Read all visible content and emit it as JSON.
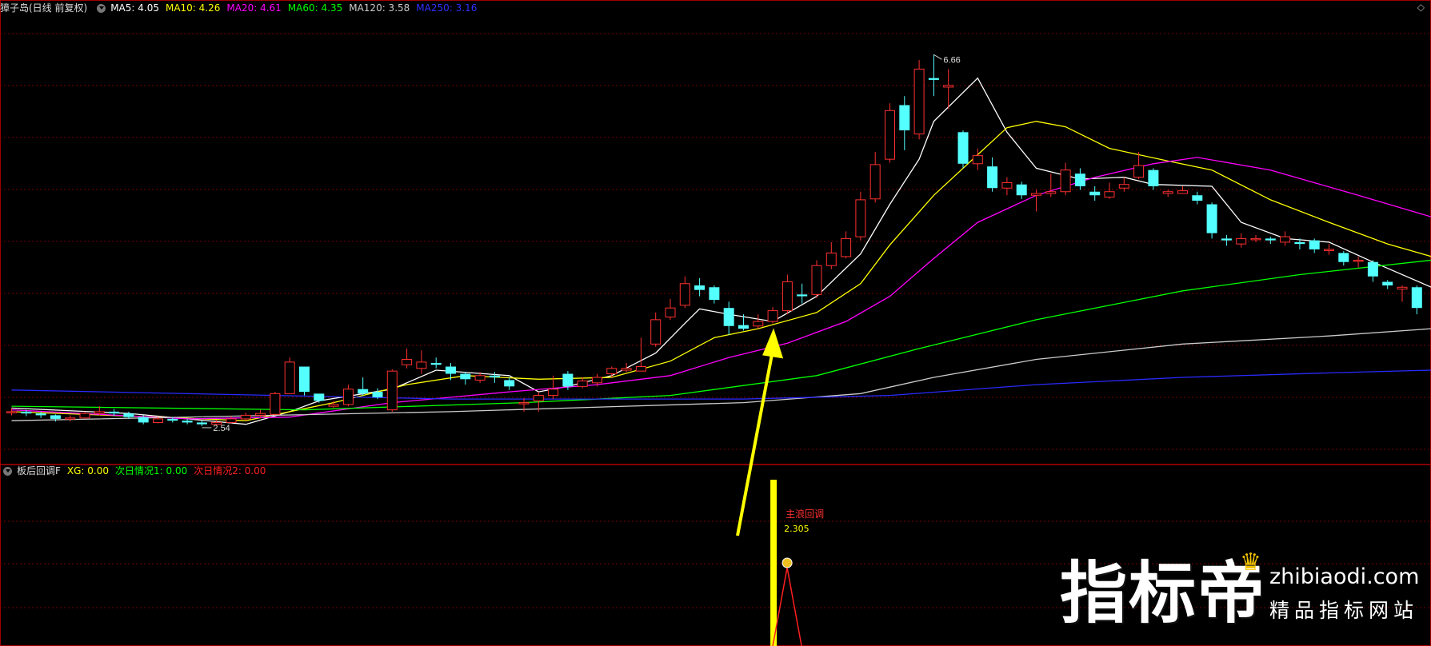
{
  "header": {
    "name": "獐子岛(日线 前复权)",
    "ma_items": [
      {
        "label": "MA5: 4.05",
        "color": "#ffffff"
      },
      {
        "label": "MA10: 4.26",
        "color": "#ffff00"
      },
      {
        "label": "MA20: 4.61",
        "color": "#ff00ff"
      },
      {
        "label": "MA60: 4.35",
        "color": "#00ff00"
      },
      {
        "label": "MA120: 3.58",
        "color": "#cccccc"
      },
      {
        "label": "MA250: 3.16",
        "color": "#3030ff"
      }
    ]
  },
  "sub_header": {
    "name": "板后回调F",
    "items": [
      {
        "label": "XG: 0.00",
        "color": "#ffff00"
      },
      {
        "label": "次日情况1: 0.00",
        "color": "#00ff00"
      },
      {
        "label": "次日情况2: 0.00",
        "color": "#ff2020"
      }
    ]
  },
  "chart_data": {
    "type": "candlestick",
    "price_range": [
      2.3,
      7.0
    ],
    "annotations": {
      "high": "6.66",
      "low": "2.54",
      "signal_label": "主浪回调",
      "signal_value": "2.305"
    },
    "colors": {
      "up": "#ff3030",
      "down": "#54ffff",
      "grid": "#7a0000",
      "arrow": "#ffff00"
    },
    "candles": [
      [
        2.7,
        2.7,
        2.74,
        2.66
      ],
      [
        2.7,
        2.68,
        2.72,
        2.65
      ],
      [
        2.68,
        2.66,
        2.7,
        2.63
      ],
      [
        2.66,
        2.62,
        2.67,
        2.59
      ],
      [
        2.62,
        2.63,
        2.66,
        2.59
      ],
      [
        2.63,
        2.68,
        2.7,
        2.62
      ],
      [
        2.68,
        2.7,
        2.76,
        2.66
      ],
      [
        2.7,
        2.68,
        2.73,
        2.65
      ],
      [
        2.68,
        2.64,
        2.7,
        2.62
      ],
      [
        2.64,
        2.58,
        2.66,
        2.56
      ],
      [
        2.58,
        2.62,
        2.64,
        2.57
      ],
      [
        2.62,
        2.6,
        2.64,
        2.58
      ],
      [
        2.6,
        2.58,
        2.62,
        2.56
      ],
      [
        2.58,
        2.56,
        2.6,
        2.54
      ],
      [
        2.56,
        2.58,
        2.61,
        2.55
      ],
      [
        2.58,
        2.62,
        2.65,
        2.57
      ],
      [
        2.62,
        2.66,
        2.69,
        2.6
      ],
      [
        2.66,
        2.68,
        2.72,
        2.63
      ],
      [
        2.67,
        2.9,
        2.92,
        2.66
      ],
      [
        2.9,
        3.25,
        3.3,
        3.18
      ],
      [
        3.2,
        2.92,
        3.05,
        2.88
      ],
      [
        2.9,
        2.82,
        2.86,
        2.8
      ],
      [
        2.76,
        2.78,
        2.82,
        2.74
      ],
      [
        2.78,
        2.95,
        3.0,
        2.76
      ],
      [
        2.95,
        2.9,
        3.08,
        2.88
      ],
      [
        2.92,
        2.86,
        2.96,
        2.84
      ],
      [
        2.72,
        3.15,
        3.17,
        2.7
      ],
      [
        3.22,
        3.28,
        3.4,
        3.18
      ],
      [
        3.18,
        3.25,
        3.38,
        3.12
      ],
      [
        3.24,
        3.22,
        3.3,
        3.18
      ],
      [
        3.2,
        3.12,
        3.24,
        3.05
      ],
      [
        3.12,
        3.06,
        3.14,
        3.0
      ],
      [
        3.05,
        3.1,
        3.14,
        3.02
      ],
      [
        3.1,
        3.08,
        3.14,
        3.02
      ],
      [
        3.05,
        2.98,
        3.08,
        2.94
      ],
      [
        2.8,
        2.8,
        2.85,
        2.7
      ],
      [
        2.82,
        2.88,
        2.92,
        2.7
      ],
      [
        2.88,
        2.95,
        3.1,
        2.84
      ],
      [
        3.12,
        2.98,
        3.15,
        2.94
      ],
      [
        2.98,
        3.04,
        3.08,
        2.96
      ],
      [
        3.02,
        3.08,
        3.12,
        2.98
      ],
      [
        3.12,
        3.18,
        3.2,
        3.08
      ],
      [
        3.16,
        3.18,
        3.24,
        3.14
      ],
      [
        3.15,
        3.2,
        3.52,
        3.15
      ],
      [
        3.45,
        3.72,
        3.8,
        3.42
      ],
      [
        3.75,
        3.85,
        3.95,
        3.72
      ],
      [
        3.88,
        4.12,
        4.2,
        3.85
      ],
      [
        4.1,
        4.05,
        4.18,
        3.98
      ],
      [
        4.08,
        3.94,
        4.1,
        3.9
      ],
      [
        3.85,
        3.65,
        3.92,
        3.55
      ],
      [
        3.66,
        3.62,
        3.78,
        3.6
      ],
      [
        3.65,
        3.7,
        3.78,
        3.62
      ],
      [
        3.7,
        3.82,
        3.86,
        3.68
      ],
      [
        3.82,
        4.14,
        4.22,
        3.78
      ],
      [
        4.0,
        3.98,
        4.12,
        3.9
      ],
      [
        4.0,
        4.32,
        4.38,
        3.96
      ],
      [
        4.32,
        4.46,
        4.58,
        4.28
      ],
      [
        4.42,
        4.62,
        4.7,
        4.4
      ],
      [
        4.64,
        5.05,
        5.14,
        4.6
      ],
      [
        5.06,
        5.44,
        5.58,
        5.02
      ],
      [
        5.5,
        6.04,
        6.12,
        5.46
      ],
      [
        6.1,
        5.82,
        6.2,
        5.6
      ],
      [
        5.78,
        6.5,
        6.6,
        5.72
      ],
      [
        6.4,
        6.38,
        6.66,
        6.2
      ],
      [
        6.3,
        6.32,
        6.5,
        6.06
      ],
      [
        5.8,
        5.45,
        5.82,
        5.4
      ],
      [
        5.45,
        5.54,
        5.62,
        5.38
      ],
      [
        5.42,
        5.18,
        5.52,
        5.14
      ],
      [
        5.18,
        5.24,
        5.3,
        5.1
      ],
      [
        5.22,
        5.1,
        5.25,
        5.06
      ],
      [
        5.1,
        5.12,
        5.16,
        4.92
      ],
      [
        5.12,
        5.14,
        5.34,
        5.08
      ],
      [
        5.14,
        5.38,
        5.46,
        5.1
      ],
      [
        5.34,
        5.2,
        5.4,
        5.16
      ],
      [
        5.14,
        5.1,
        5.2,
        5.04
      ],
      [
        5.08,
        5.14,
        5.24,
        5.06
      ],
      [
        5.18,
        5.22,
        5.3,
        5.14
      ],
      [
        5.3,
        5.43,
        5.58,
        5.28
      ],
      [
        5.38,
        5.2,
        5.4,
        5.16
      ],
      [
        5.12,
        5.14,
        5.16,
        5.08
      ],
      [
        5.12,
        5.15,
        5.2,
        5.12
      ],
      [
        5.1,
        5.04,
        5.14,
        5.0
      ],
      [
        5.0,
        4.68,
        5.02,
        4.62
      ],
      [
        4.62,
        4.6,
        4.66,
        4.54
      ],
      [
        4.56,
        4.62,
        4.68,
        4.52
      ],
      [
        4.62,
        4.62,
        4.66,
        4.58
      ],
      [
        4.62,
        4.6,
        4.64,
        4.56
      ],
      [
        4.58,
        4.64,
        4.7,
        4.54
      ],
      [
        4.58,
        4.56,
        4.62,
        4.5
      ],
      [
        4.6,
        4.5,
        4.62,
        4.46
      ],
      [
        4.5,
        4.5,
        4.56,
        4.44
      ],
      [
        4.46,
        4.36,
        4.48,
        4.32
      ],
      [
        4.38,
        4.38,
        4.42,
        4.3
      ],
      [
        4.36,
        4.2,
        4.38,
        4.14
      ],
      [
        4.14,
        4.1,
        4.16,
        4.06
      ],
      [
        4.06,
        4.08,
        4.1,
        3.92
      ],
      [
        4.08,
        3.85,
        4.1,
        3.78
      ]
    ],
    "ma": [
      {
        "name": "MA5",
        "color": "#ffffff",
        "values": [
          [
            0,
            2.74
          ],
          [
            8,
            2.68
          ],
          [
            16,
            2.56
          ],
          [
            19,
            2.7
          ],
          [
            21,
            2.82
          ],
          [
            26,
            2.95
          ],
          [
            29,
            3.16
          ],
          [
            34,
            3.1
          ],
          [
            36,
            2.92
          ],
          [
            38,
            2.98
          ],
          [
            41,
            3.1
          ],
          [
            44,
            3.35
          ],
          [
            46,
            3.68
          ],
          [
            47,
            3.84
          ],
          [
            49,
            3.78
          ],
          [
            52,
            3.7
          ],
          [
            55,
            3.98
          ],
          [
            58,
            4.45
          ],
          [
            60,
            5.0
          ],
          [
            62,
            5.5
          ],
          [
            63,
            5.92
          ],
          [
            66,
            6.4
          ],
          [
            68,
            5.8
          ],
          [
            70,
            5.4
          ],
          [
            73,
            5.28
          ],
          [
            76,
            5.3
          ],
          [
            78,
            5.22
          ],
          [
            82,
            5.2
          ],
          [
            84,
            4.8
          ],
          [
            87,
            4.62
          ],
          [
            90,
            4.58
          ],
          [
            93,
            4.36
          ],
          [
            97,
            4.08
          ]
        ]
      },
      {
        "name": "MA10",
        "color": "#ffff00",
        "values": [
          [
            0,
            2.7
          ],
          [
            10,
            2.64
          ],
          [
            16,
            2.6
          ],
          [
            22,
            2.8
          ],
          [
            27,
            3.0
          ],
          [
            31,
            3.1
          ],
          [
            36,
            3.06
          ],
          [
            41,
            3.08
          ],
          [
            45,
            3.26
          ],
          [
            48,
            3.52
          ],
          [
            51,
            3.62
          ],
          [
            55,
            3.8
          ],
          [
            58,
            4.12
          ],
          [
            60,
            4.55
          ],
          [
            63,
            5.1
          ],
          [
            66,
            5.55
          ],
          [
            68,
            5.85
          ],
          [
            70,
            5.92
          ],
          [
            72,
            5.86
          ],
          [
            75,
            5.62
          ],
          [
            79,
            5.48
          ],
          [
            82,
            5.38
          ],
          [
            86,
            5.05
          ],
          [
            90,
            4.8
          ],
          [
            94,
            4.56
          ],
          [
            97,
            4.42
          ]
        ]
      },
      {
        "name": "MA20",
        "color": "#ff00ff",
        "values": [
          [
            0,
            2.72
          ],
          [
            12,
            2.62
          ],
          [
            19,
            2.64
          ],
          [
            26,
            2.8
          ],
          [
            34,
            2.92
          ],
          [
            40,
            3.0
          ],
          [
            45,
            3.1
          ],
          [
            49,
            3.3
          ],
          [
            53,
            3.46
          ],
          [
            57,
            3.7
          ],
          [
            60,
            3.98
          ],
          [
            63,
            4.4
          ],
          [
            66,
            4.8
          ],
          [
            70,
            5.1
          ],
          [
            74,
            5.3
          ],
          [
            78,
            5.45
          ],
          [
            81,
            5.52
          ],
          [
            86,
            5.38
          ],
          [
            92,
            5.1
          ],
          [
            97,
            4.86
          ]
        ]
      },
      {
        "name": "MA60",
        "color": "#00ff00",
        "values": [
          [
            0,
            2.76
          ],
          [
            20,
            2.72
          ],
          [
            35,
            2.8
          ],
          [
            45,
            2.88
          ],
          [
            55,
            3.1
          ],
          [
            62,
            3.4
          ],
          [
            70,
            3.72
          ],
          [
            80,
            4.04
          ],
          [
            88,
            4.22
          ],
          [
            97,
            4.38
          ]
        ]
      },
      {
        "name": "MA120",
        "color": "#cccccc",
        "values": [
          [
            0,
            2.6
          ],
          [
            30,
            2.7
          ],
          [
            50,
            2.8
          ],
          [
            58,
            2.9
          ],
          [
            63,
            3.08
          ],
          [
            70,
            3.28
          ],
          [
            80,
            3.45
          ],
          [
            90,
            3.54
          ],
          [
            97,
            3.62
          ]
        ]
      },
      {
        "name": "MA250",
        "color": "#2a2aff",
        "values": [
          [
            0,
            2.94
          ],
          [
            30,
            2.84
          ],
          [
            50,
            2.84
          ],
          [
            60,
            2.88
          ],
          [
            70,
            3.0
          ],
          [
            80,
            3.08
          ],
          [
            90,
            3.13
          ],
          [
            97,
            3.16
          ]
        ]
      }
    ],
    "indicator": {
      "signal_index": 52,
      "signal_value": 2.305
    }
  },
  "watermark": {
    "logo": "指标帝",
    "domain": "zhibiaodi.com",
    "slogan": "精品指标网站"
  }
}
